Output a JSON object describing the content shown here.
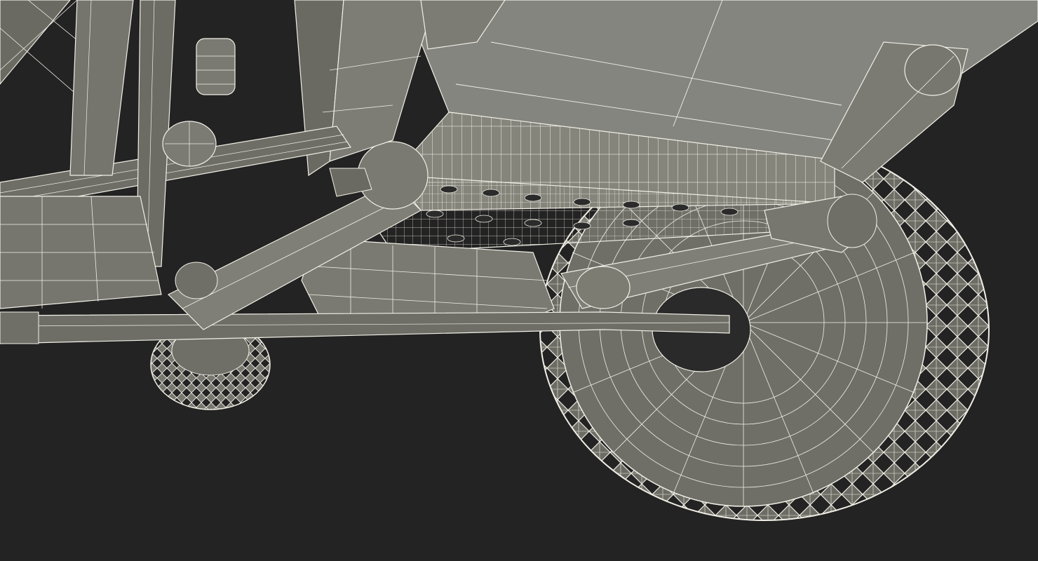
{
  "scene": {
    "background": "#232323",
    "surface": "#7c7c73",
    "surface_light": "#8a8a80",
    "surface_dark": "#5e5e57",
    "wire": "#f1efe6",
    "wire_dim": "#d9d7cd",
    "hole": "#2b2b2b"
  }
}
